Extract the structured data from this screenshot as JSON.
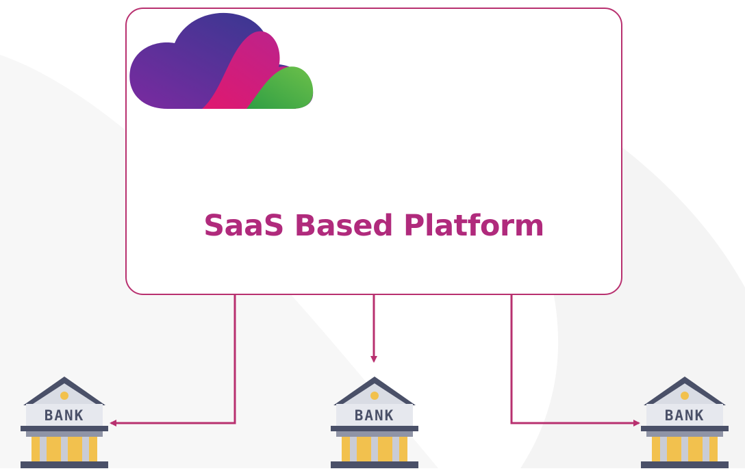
{
  "platform": {
    "title": "SaaS Based Platform",
    "border_color": "#b8306f",
    "title_color": "#b02a7c"
  },
  "connectors": {
    "color": "#b8306f"
  },
  "banks": [
    {
      "label": "BANK"
    },
    {
      "label": "BANK"
    },
    {
      "label": "BANK"
    }
  ],
  "logo": {
    "icon": "cloud-logo-icon",
    "colors": [
      "#2f3a8f",
      "#7b2aa0",
      "#d81b7a",
      "#3fae49"
    ]
  }
}
